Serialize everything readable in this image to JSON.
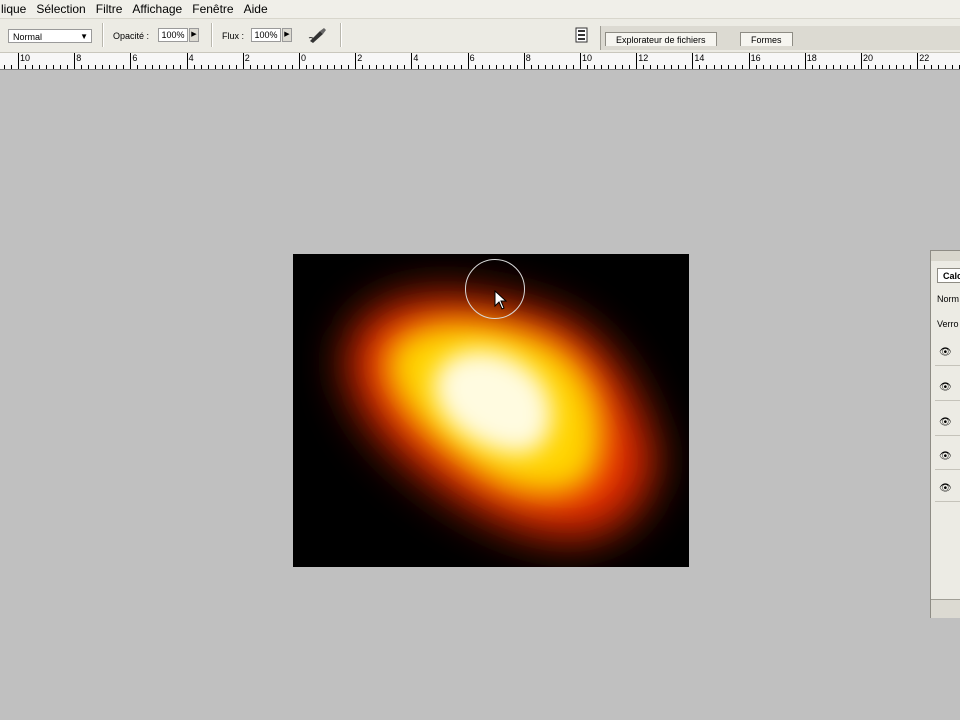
{
  "menu": [
    "lique",
    "Sélection",
    "Filtre",
    "Affichage",
    "Fenêtre",
    "Aide"
  ],
  "options": {
    "mode_label": "Normal",
    "opacity_label": "Opacité :",
    "opacity_value": "100%",
    "flow_label": "Flux :",
    "flow_value": "100%"
  },
  "well_tabs": [
    "Explorateur de fichiers",
    "Formes"
  ],
  "ruler": {
    "labels": [
      "10",
      "8",
      "6",
      "4",
      "2",
      "0",
      "2",
      "4",
      "6",
      "8",
      "10",
      "12",
      "14",
      "16",
      "18",
      "20",
      "22"
    ]
  },
  "layers_panel": {
    "tab_label": "Calc",
    "mode_text": "Norm",
    "lock_text": "Verro",
    "eye_icon": "eye-icon"
  },
  "colors": {
    "workspace": "#c0c0c0",
    "canvas_bg": "#000000",
    "glow_core": "#fffbe0",
    "glow_mid": "#ffd400",
    "glow_outer": "#e52b00"
  }
}
